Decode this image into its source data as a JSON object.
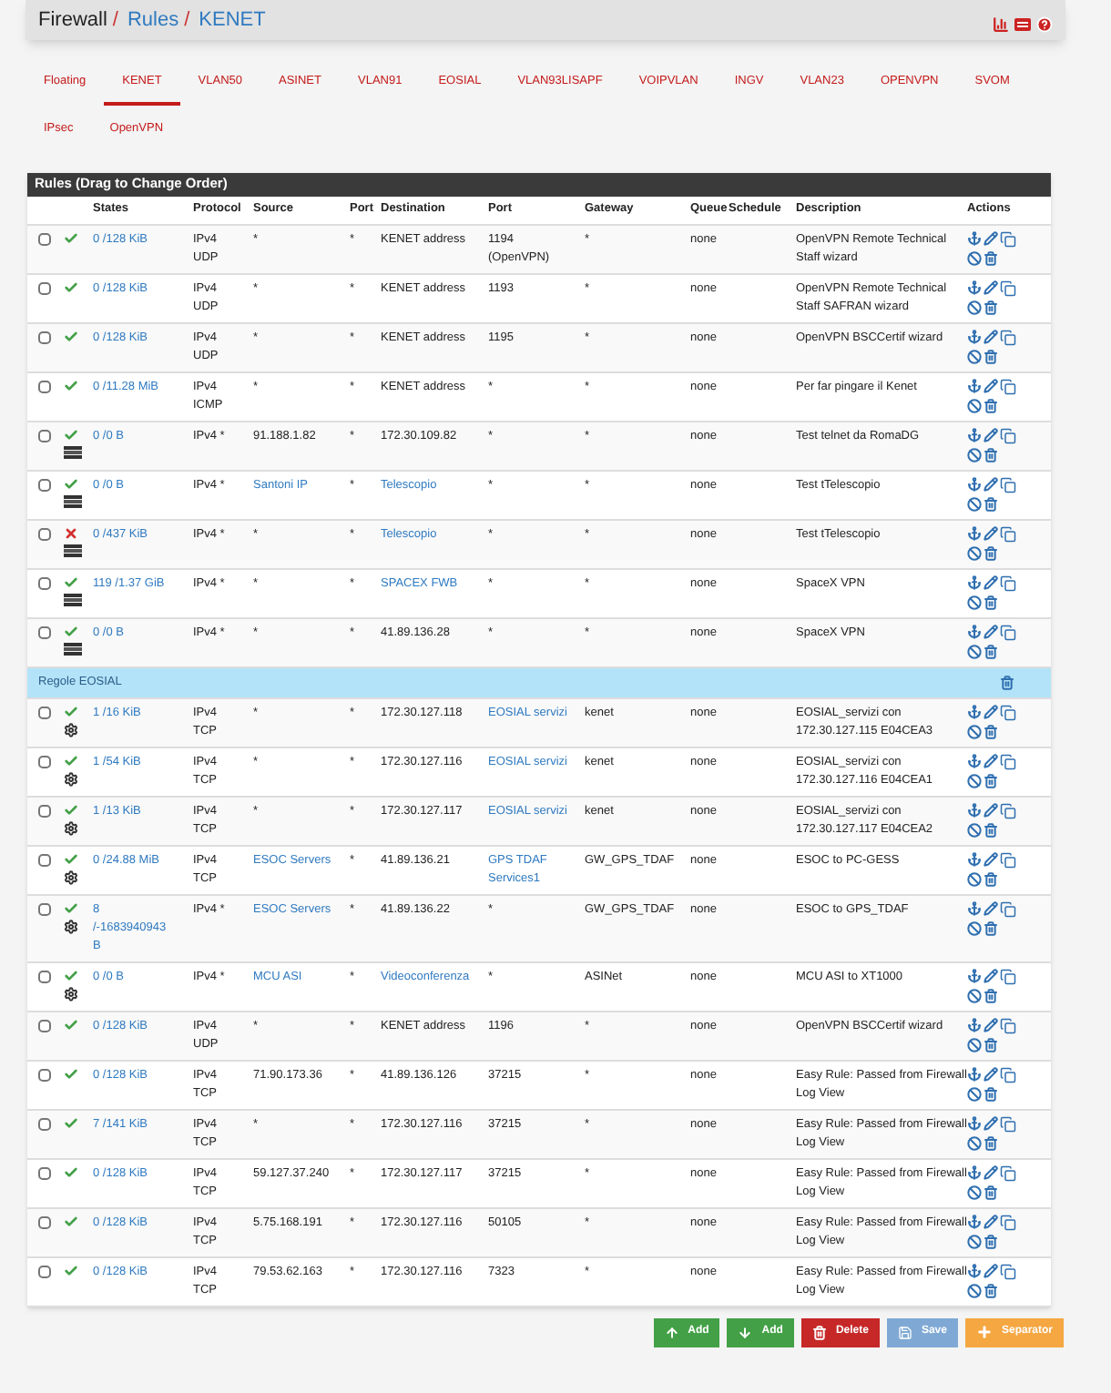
{
  "breadcrumb": [
    {
      "text": "Firewall",
      "kind": "root"
    },
    {
      "text": "/",
      "kind": "separator"
    },
    {
      "text": "Rules",
      "kind": "link"
    },
    {
      "text": "/",
      "kind": "separator"
    },
    {
      "text": "KENET",
      "kind": "link"
    }
  ],
  "tabs": [
    {
      "label": "Floating",
      "selected": false
    },
    {
      "label": "KENET",
      "selected": true
    },
    {
      "label": "VLAN50",
      "selected": false
    },
    {
      "label": "ASINET",
      "selected": false
    },
    {
      "label": "VLAN91",
      "selected": false
    },
    {
      "label": "EOSIAL",
      "selected": false
    },
    {
      "label": "VLAN93LISAPF",
      "selected": false
    },
    {
      "label": "VOIPVLAN",
      "selected": false
    },
    {
      "label": "INGV",
      "selected": false
    },
    {
      "label": "VLAN23",
      "selected": false
    },
    {
      "label": "OPENVPN",
      "selected": false
    },
    {
      "label": "SVOM",
      "selected": false
    },
    {
      "label": "IPsec",
      "selected": false
    },
    {
      "label": "OpenVPN",
      "selected": false
    }
  ],
  "table": {
    "title": "Rules (Drag to Change Order)",
    "columns": [
      "States",
      "Protocol",
      "Source",
      "Port",
      "Destination",
      "Port",
      "Gateway",
      "Queue",
      "Schedule",
      "Description",
      "Actions"
    ],
    "rows": [
      {
        "kind": "rule",
        "checked": false,
        "blocked": false,
        "log": false,
        "advanced": false,
        "states": "0 /128 KiB",
        "protocol": "IPv4\nUDP",
        "source": "*",
        "source_alias": false,
        "sport": "*",
        "destination": "KENET address",
        "destination_alias": false,
        "dport": "1194\n(OpenVPN)",
        "dport_alias": false,
        "gateway": "*",
        "queue": "none",
        "description": "OpenVPN Remote Technical Staff wizard"
      },
      {
        "kind": "rule",
        "checked": false,
        "blocked": false,
        "log": false,
        "advanced": false,
        "states": "0 /128 KiB",
        "protocol": "IPv4\nUDP",
        "source": "*",
        "source_alias": false,
        "sport": "*",
        "destination": "KENET address",
        "destination_alias": false,
        "dport": "1193",
        "dport_alias": false,
        "gateway": "*",
        "queue": "none",
        "description": "OpenVPN Remote Technical Staff SAFRAN wizard"
      },
      {
        "kind": "rule",
        "checked": false,
        "blocked": false,
        "log": false,
        "advanced": false,
        "states": "0 /128 KiB",
        "protocol": "IPv4\nUDP",
        "source": "*",
        "source_alias": false,
        "sport": "*",
        "destination": "KENET address",
        "destination_alias": false,
        "dport": "1195",
        "dport_alias": false,
        "gateway": "*",
        "queue": "none",
        "description": "OpenVPN BSCCertif wizard"
      },
      {
        "kind": "rule",
        "checked": false,
        "blocked": false,
        "log": false,
        "advanced": false,
        "states": "0 /11.28 MiB",
        "protocol": "IPv4\nICMP",
        "source": "*",
        "source_alias": false,
        "sport": "*",
        "destination": "KENET address",
        "destination_alias": false,
        "dport": "*",
        "dport_alias": false,
        "gateway": "*",
        "queue": "none",
        "description": "Per far pingare il Kenet"
      },
      {
        "kind": "rule",
        "checked": false,
        "blocked": false,
        "log": true,
        "advanced": false,
        "states": "0 /0 B",
        "protocol": "IPv4 *",
        "source": "91.188.1.82",
        "source_alias": false,
        "sport": "*",
        "destination": "172.30.109.82",
        "destination_alias": false,
        "dport": "*",
        "dport_alias": false,
        "gateway": "*",
        "queue": "none",
        "description": "Test telnet da RomaDG"
      },
      {
        "kind": "rule",
        "checked": false,
        "blocked": false,
        "log": true,
        "advanced": false,
        "states": "0 /0 B",
        "protocol": "IPv4 *",
        "source": "Santoni IP",
        "source_alias": true,
        "sport": "*",
        "destination": "Telescopio",
        "destination_alias": true,
        "dport": "*",
        "dport_alias": false,
        "gateway": "*",
        "queue": "none",
        "description": "Test tTelescopio"
      },
      {
        "kind": "rule",
        "checked": false,
        "blocked": true,
        "log": true,
        "advanced": false,
        "states": "0 /437 KiB",
        "protocol": "IPv4 *",
        "source": "*",
        "source_alias": false,
        "sport": "*",
        "destination": "Telescopio",
        "destination_alias": true,
        "dport": "*",
        "dport_alias": false,
        "gateway": "*",
        "queue": "none",
        "description": "Test tTelescopio"
      },
      {
        "kind": "rule",
        "checked": false,
        "blocked": false,
        "log": true,
        "advanced": false,
        "states": "119 /1.37 GiB",
        "protocol": "IPv4 *",
        "source": "*",
        "source_alias": false,
        "sport": "*",
        "destination": "SPACEX FWB",
        "destination_alias": true,
        "dport": "*",
        "dport_alias": false,
        "gateway": "*",
        "queue": "none",
        "description": "SpaceX VPN"
      },
      {
        "kind": "rule",
        "checked": false,
        "blocked": false,
        "log": true,
        "advanced": false,
        "states": "0 /0 B",
        "protocol": "IPv4 *",
        "source": "*",
        "source_alias": false,
        "sport": "*",
        "destination": "41.89.136.28",
        "destination_alias": false,
        "dport": "*",
        "dport_alias": false,
        "gateway": "*",
        "queue": "none",
        "description": "SpaceX VPN"
      },
      {
        "kind": "separator",
        "label": "Regole EOSIAL"
      },
      {
        "kind": "rule",
        "checked": false,
        "blocked": false,
        "log": false,
        "advanced": true,
        "states": "1 /16 KiB",
        "protocol": "IPv4\nTCP",
        "source": "*",
        "source_alias": false,
        "sport": "*",
        "destination": "172.30.127.118",
        "destination_alias": false,
        "dport": "EOSIAL servizi",
        "dport_alias": true,
        "gateway": "kenet",
        "queue": "none",
        "description": "EOSIAL_servizi con 172.30.127.115 E04CEA3"
      },
      {
        "kind": "rule",
        "checked": false,
        "blocked": false,
        "log": false,
        "advanced": true,
        "states": "1 /54 KiB",
        "protocol": "IPv4\nTCP",
        "source": "*",
        "source_alias": false,
        "sport": "*",
        "destination": "172.30.127.116",
        "destination_alias": false,
        "dport": "EOSIAL servizi",
        "dport_alias": true,
        "gateway": "kenet",
        "queue": "none",
        "description": "EOSIAL_servizi con 172.30.127.116 E04CEA1"
      },
      {
        "kind": "rule",
        "checked": false,
        "blocked": false,
        "log": false,
        "advanced": true,
        "states": "1 /13 KiB",
        "protocol": "IPv4\nTCP",
        "source": "*",
        "source_alias": false,
        "sport": "*",
        "destination": "172.30.127.117",
        "destination_alias": false,
        "dport": "EOSIAL servizi",
        "dport_alias": true,
        "gateway": "kenet",
        "queue": "none",
        "description": "EOSIAL_servizi con 172.30.127.117 E04CEA2"
      },
      {
        "kind": "rule",
        "checked": false,
        "blocked": false,
        "log": false,
        "advanced": true,
        "states": "0 /24.88 MiB",
        "protocol": "IPv4\nTCP",
        "source": "ESOC Servers",
        "source_alias": true,
        "sport": "*",
        "destination": "41.89.136.21",
        "destination_alias": false,
        "dport": "GPS TDAF\nServices1",
        "dport_alias": true,
        "gateway": "GW_GPS_TDAF",
        "queue": "none",
        "description": "ESOC to PC-GESS"
      },
      {
        "kind": "rule",
        "checked": false,
        "blocked": false,
        "log": false,
        "advanced": true,
        "states": "8\n/-1683940943\nB",
        "protocol": "IPv4 *",
        "source": "ESOC Servers",
        "source_alias": true,
        "sport": "*",
        "destination": "41.89.136.22",
        "destination_alias": false,
        "dport": "*",
        "dport_alias": false,
        "gateway": "GW_GPS_TDAF",
        "queue": "none",
        "description": "ESOC to GPS_TDAF"
      },
      {
        "kind": "rule",
        "checked": false,
        "blocked": false,
        "log": false,
        "advanced": true,
        "states": "0 /0 B",
        "protocol": "IPv4 *",
        "source": "MCU ASI",
        "source_alias": true,
        "sport": "*",
        "destination": "Videoconferenza",
        "destination_alias": true,
        "dport": "*",
        "dport_alias": false,
        "gateway": "ASINet",
        "queue": "none",
        "description": "MCU ASI to XT1000"
      },
      {
        "kind": "rule",
        "checked": false,
        "blocked": false,
        "log": false,
        "advanced": false,
        "states": "0 /128 KiB",
        "protocol": "IPv4\nUDP",
        "source": "*",
        "source_alias": false,
        "sport": "*",
        "destination": "KENET address",
        "destination_alias": false,
        "dport": "1196",
        "dport_alias": false,
        "gateway": "*",
        "queue": "none",
        "description": "OpenVPN BSCCertif wizard"
      },
      {
        "kind": "rule",
        "checked": false,
        "blocked": false,
        "log": false,
        "advanced": false,
        "states": "0 /128 KiB",
        "protocol": "IPv4\nTCP",
        "source": "71.90.173.36",
        "source_alias": false,
        "sport": "*",
        "destination": "41.89.136.126",
        "destination_alias": false,
        "dport": "37215",
        "dport_alias": false,
        "gateway": "*",
        "queue": "none",
        "description": "Easy Rule: Passed from Firewall Log View"
      },
      {
        "kind": "rule",
        "checked": false,
        "blocked": false,
        "log": false,
        "advanced": false,
        "states": "7 /141 KiB",
        "protocol": "IPv4\nTCP",
        "source": "*",
        "source_alias": false,
        "sport": "*",
        "destination": "172.30.127.116",
        "destination_alias": false,
        "dport": "37215",
        "dport_alias": false,
        "gateway": "*",
        "queue": "none",
        "description": "Easy Rule: Passed from Firewall Log View"
      },
      {
        "kind": "rule",
        "checked": false,
        "blocked": false,
        "log": false,
        "advanced": false,
        "states": "0 /128 KiB",
        "protocol": "IPv4\nTCP",
        "source": "59.127.37.240",
        "source_alias": false,
        "sport": "*",
        "destination": "172.30.127.117",
        "destination_alias": false,
        "dport": "37215",
        "dport_alias": false,
        "gateway": "*",
        "queue": "none",
        "description": "Easy Rule: Passed from Firewall Log View"
      },
      {
        "kind": "rule",
        "checked": false,
        "blocked": false,
        "log": false,
        "advanced": false,
        "states": "0 /128 KiB",
        "protocol": "IPv4\nTCP",
        "source": "5.75.168.191",
        "source_alias": false,
        "sport": "*",
        "destination": "172.30.127.116",
        "destination_alias": false,
        "dport": "50105",
        "dport_alias": false,
        "gateway": "*",
        "queue": "none",
        "description": "Easy Rule: Passed from Firewall Log View"
      },
      {
        "kind": "rule",
        "checked": false,
        "blocked": false,
        "log": false,
        "advanced": false,
        "states": "0 /128 KiB",
        "protocol": "IPv4\nTCP",
        "source": "79.53.62.163",
        "source_alias": false,
        "sport": "*",
        "destination": "172.30.127.116",
        "destination_alias": false,
        "dport": "7323",
        "dport_alias": false,
        "gateway": "*",
        "queue": "none",
        "description": "Easy Rule: Passed from Firewall Log View"
      }
    ]
  },
  "buttons": [
    {
      "label": "Add",
      "kind": "add_top"
    },
    {
      "label": "Add",
      "kind": "add_bottom"
    },
    {
      "label": "Delete",
      "kind": "delete"
    },
    {
      "label": "Save",
      "kind": "save"
    },
    {
      "label": "Separator",
      "kind": "separator"
    }
  ]
}
